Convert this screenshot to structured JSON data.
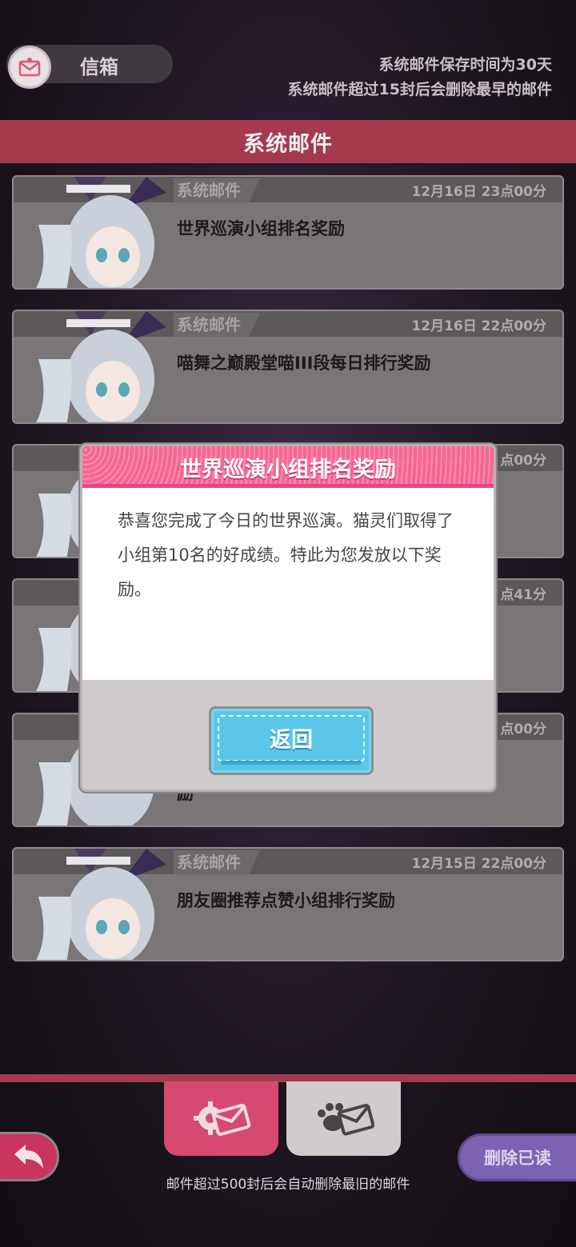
{
  "header": {
    "title": "信箱",
    "info_line1": "系统邮件保存时间为30天",
    "info_line2": "系统邮件超过15封后会删除最早的邮件"
  },
  "section_title": "系统邮件",
  "mails": [
    {
      "tag": "系统邮件",
      "date": "12月16日 23点00分",
      "subject": "世界巡演小组排名奖励"
    },
    {
      "tag": "系统邮件",
      "date": "12月16日 22点00分",
      "subject": "喵舞之巅殿堂喵III段每日排行奖励"
    },
    {
      "tag": "",
      "date": "点00分",
      "subject": ""
    },
    {
      "tag": "",
      "date": "点41分",
      "subject": ""
    },
    {
      "tag": "",
      "date": "点00分",
      "subject": "励"
    },
    {
      "tag": "系统邮件",
      "date": "12月15日 22点00分",
      "subject": "朋友圈推荐点赞小组排行奖励"
    }
  ],
  "modal": {
    "title": "世界巡演小组排名奖励",
    "body": "恭喜您完成了今日的世界巡演。猫灵们取得了小组第10名的好成绩。特此为您发放以下奖励。",
    "back_label": "返回"
  },
  "footer": {
    "delete_read_label": "删除已读",
    "note": "邮件超过500封后会自动删除最旧的邮件"
  },
  "colors": {
    "accent_pink": "#a5394e",
    "modal_header": "#f56792",
    "button_blue": "#5ac6ea",
    "delete_purple": "#7c63b2"
  },
  "icons": [
    "envelope-icon",
    "gear-envelope-icon",
    "paw-envelope-icon",
    "back-arrow-icon"
  ]
}
